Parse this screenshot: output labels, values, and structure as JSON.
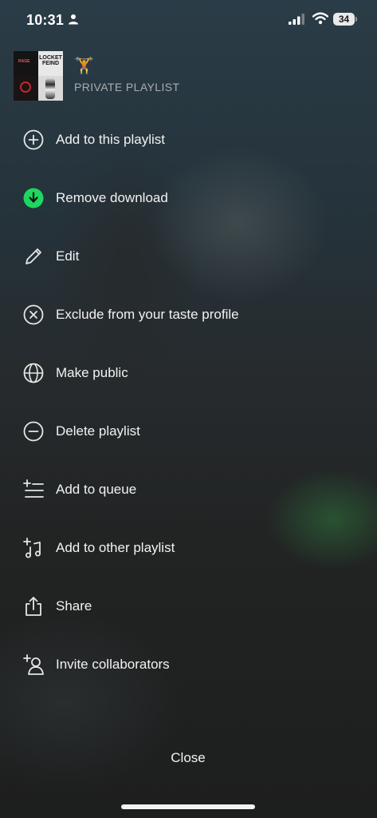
{
  "status_bar": {
    "time": "10:31",
    "battery": "34",
    "icons": [
      "person-icon",
      "signal-icon",
      "wifi-icon",
      "battery-icon"
    ]
  },
  "playlist": {
    "cover_text_top": "LOCKET\nFEIND",
    "cover_text_small": "RAGE",
    "emoji": "🏋️",
    "subtitle": "PRIVATE PLAYLIST"
  },
  "menu": {
    "items": [
      {
        "label": "Add to this playlist",
        "icon": "plus-circle-icon"
      },
      {
        "label": "Remove download",
        "icon": "download-complete-icon"
      },
      {
        "label": "Edit",
        "icon": "pencil-icon"
      },
      {
        "label": "Exclude from your taste profile",
        "icon": "x-circle-icon"
      },
      {
        "label": "Make public",
        "icon": "globe-icon"
      },
      {
        "label": "Delete playlist",
        "icon": "minus-circle-icon"
      },
      {
        "label": "Add to queue",
        "icon": "add-queue-icon"
      },
      {
        "label": "Add to other playlist",
        "icon": "add-playlist-icon"
      },
      {
        "label": "Share",
        "icon": "share-icon"
      },
      {
        "label": "Invite collaborators",
        "icon": "add-user-icon"
      }
    ]
  },
  "footer": {
    "close_label": "Close"
  },
  "colors": {
    "accent_green": "#1ed760",
    "text": "#f2f2f2",
    "muted": "#a8adb0"
  }
}
